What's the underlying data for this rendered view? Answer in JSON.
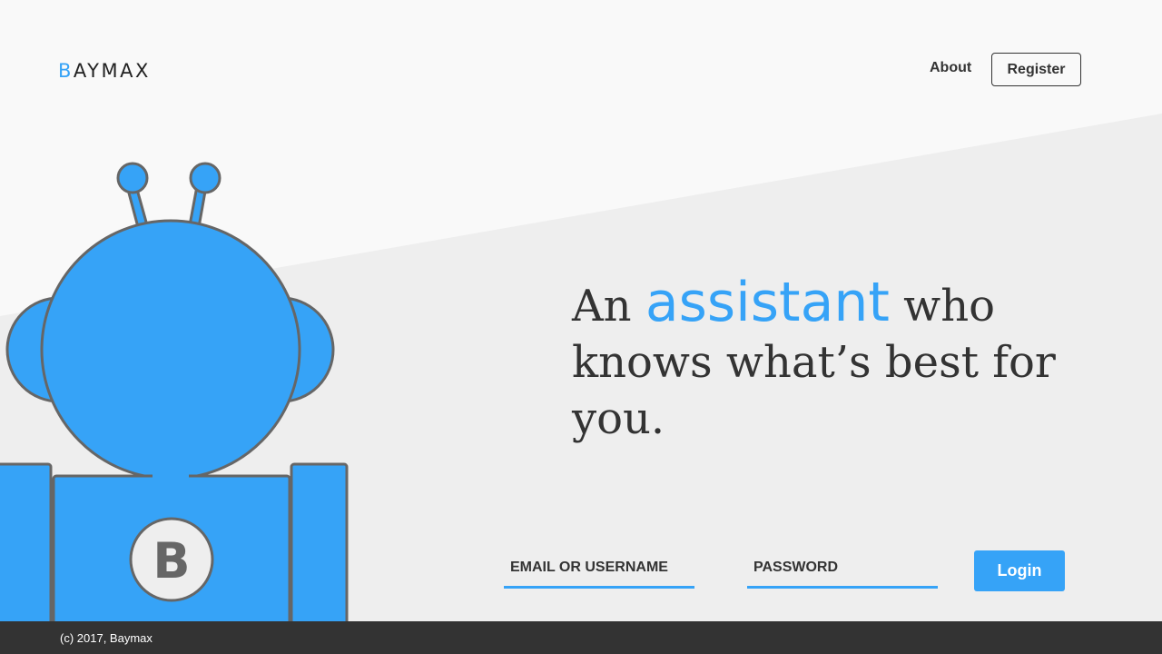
{
  "brand": {
    "logo_first": "B",
    "logo_rest": "AYMAX",
    "accent_color": "#36a3f7",
    "robot_emblem_letter": "B"
  },
  "nav": {
    "about_label": "About",
    "register_label": "Register"
  },
  "hero": {
    "line_prefix": "An",
    "accent_word": "assistant",
    "line_suffix": "who knows what’s best for you."
  },
  "login_form": {
    "email_placeholder": "EMAIL OR USERNAME",
    "password_placeholder": "PASSWORD",
    "login_label": "Login"
  },
  "footer": {
    "copyright": "(c) 2017, Baymax"
  }
}
